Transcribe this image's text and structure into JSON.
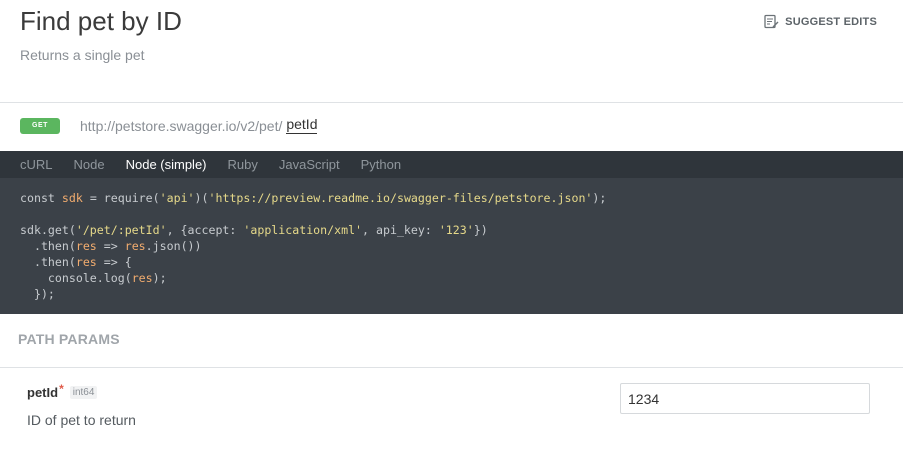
{
  "header": {
    "title": "Find pet by ID",
    "subtitle": "Returns a single pet",
    "suggest_edits_label": "SUGGEST EDITS",
    "suggest_edits_icon": "edit-icon"
  },
  "endpoint": {
    "method": "GET",
    "url_base": "http://petstore.swagger.io/v2/pet/",
    "url_param": "petId",
    "method_color": "#5bb65f"
  },
  "code_panel": {
    "tabs": [
      {
        "label": "cURL",
        "active": false
      },
      {
        "label": "Node",
        "active": false
      },
      {
        "label": "Node (simple)",
        "active": true
      },
      {
        "label": "Ruby",
        "active": false
      },
      {
        "label": "JavaScript",
        "active": false
      },
      {
        "label": "Python",
        "active": false
      }
    ],
    "lines": [
      {
        "t": [
          {
            "c": "const ",
            "k": "k"
          },
          {
            "c": "sdk",
            "k": "v"
          },
          {
            "c": " = require(",
            "k": "k"
          },
          {
            "c": "'api'",
            "k": "s"
          },
          {
            "c": ")(",
            "k": "k"
          },
          {
            "c": "'https://preview.readme.io/swagger-files/petstore.json'",
            "k": "s"
          },
          {
            "c": ");",
            "k": "k"
          }
        ]
      },
      {
        "t": []
      },
      {
        "t": [
          {
            "c": "sdk.get(",
            "k": "k"
          },
          {
            "c": "'/pet/:petId'",
            "k": "s"
          },
          {
            "c": ", {accept: ",
            "k": "k"
          },
          {
            "c": "'application/xml'",
            "k": "s"
          },
          {
            "c": ", api_key: ",
            "k": "k"
          },
          {
            "c": "'123'",
            "k": "s"
          },
          {
            "c": "})",
            "k": "k"
          }
        ]
      },
      {
        "t": [
          {
            "c": "  .then(",
            "k": "k"
          },
          {
            "c": "res",
            "k": "v"
          },
          {
            "c": " => ",
            "k": "k"
          },
          {
            "c": "res",
            "k": "v"
          },
          {
            "c": ".json())",
            "k": "k"
          }
        ]
      },
      {
        "t": [
          {
            "c": "  .then(",
            "k": "k"
          },
          {
            "c": "res",
            "k": "v"
          },
          {
            "c": " => {",
            "k": "k"
          }
        ]
      },
      {
        "t": [
          {
            "c": "    console.log(",
            "k": "k"
          },
          {
            "c": "res",
            "k": "v"
          },
          {
            "c": ");",
            "k": "k"
          }
        ]
      },
      {
        "t": [
          {
            "c": "  });",
            "k": "k"
          }
        ]
      }
    ],
    "background": "#3b4148"
  },
  "path_params": {
    "section_title": "PATH PARAMS",
    "param": {
      "name": "petId",
      "required_marker": "*",
      "type": "int64",
      "description": "ID of pet to return",
      "value": "1234"
    }
  }
}
